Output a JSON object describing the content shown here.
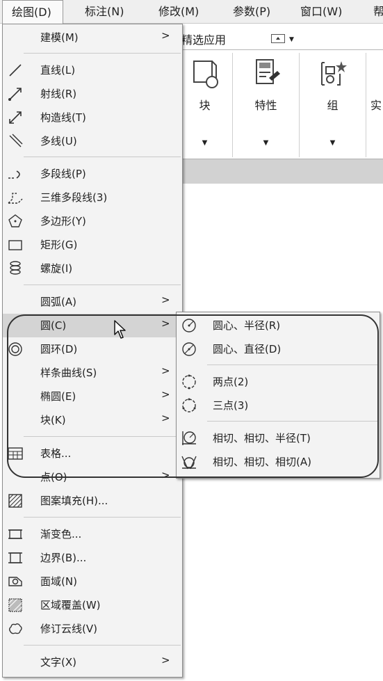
{
  "menubar": {
    "items": [
      "绘图(D)",
      "标注(N)",
      "修改(M)",
      "参数(P)",
      "窗口(W)",
      "帮"
    ]
  },
  "ribbon": {
    "tab_label": "精选应用",
    "panels": [
      "块",
      "特性",
      "组",
      "实"
    ]
  },
  "draw_menu": {
    "items": [
      {
        "label": "建模(M)",
        "icon": "none",
        "submenu": true
      },
      {
        "label": "直线(L)",
        "icon": "line-icon"
      },
      {
        "label": "射线(R)",
        "icon": "ray-icon"
      },
      {
        "label": "构造线(T)",
        "icon": "xline-icon"
      },
      {
        "label": "多线(U)",
        "icon": "multiline-icon"
      },
      {
        "label": "多段线(P)",
        "icon": "polyline-icon"
      },
      {
        "label": "三维多段线(3)",
        "icon": "3d-polyline-icon"
      },
      {
        "label": "多边形(Y)",
        "icon": "polygon-icon"
      },
      {
        "label": "矩形(G)",
        "icon": "rectangle-icon"
      },
      {
        "label": "螺旋(I)",
        "icon": "helix-icon"
      },
      {
        "label": "圆弧(A)",
        "icon": "none",
        "submenu": true
      },
      {
        "label": "圆(C)",
        "icon": "none",
        "submenu": true
      },
      {
        "label": "圆环(D)",
        "icon": "donut-icon"
      },
      {
        "label": "样条曲线(S)",
        "icon": "none",
        "submenu": true
      },
      {
        "label": "椭圆(E)",
        "icon": "none",
        "submenu": true
      },
      {
        "label": "块(K)",
        "icon": "none",
        "submenu": true
      },
      {
        "label": "表格...",
        "icon": "table-icon"
      },
      {
        "label": "点(O)",
        "icon": "none",
        "submenu": true
      },
      {
        "label": "图案填充(H)...",
        "icon": "hatch-icon"
      },
      {
        "label": "渐变色...",
        "icon": "gradient-icon"
      },
      {
        "label": "边界(B)...",
        "icon": "boundary-icon"
      },
      {
        "label": "面域(N)",
        "icon": "region-icon"
      },
      {
        "label": "区域覆盖(W)",
        "icon": "wipeout-icon"
      },
      {
        "label": "修订云线(V)",
        "icon": "revcloud-icon"
      },
      {
        "label": "文字(X)",
        "icon": "none",
        "submenu": true
      }
    ],
    "arrow": ">"
  },
  "circle_submenu": {
    "items": [
      {
        "label": "圆心、半径(R)",
        "icon": "circle-center-radius-icon"
      },
      {
        "label": "圆心、直径(D)",
        "icon": "circle-center-diameter-icon"
      },
      {
        "label": "两点(2)",
        "icon": "circle-2point-icon"
      },
      {
        "label": "三点(3)",
        "icon": "circle-3point-icon"
      },
      {
        "label": "相切、相切、半径(T)",
        "icon": "circle-ttr-icon"
      },
      {
        "label": "相切、相切、相切(A)",
        "icon": "circle-ttt-icon"
      }
    ]
  },
  "colors": {
    "menu_bg": "#f3f3f3",
    "highlight": "#d4d4d4",
    "menubar_bg": "#efefef"
  }
}
